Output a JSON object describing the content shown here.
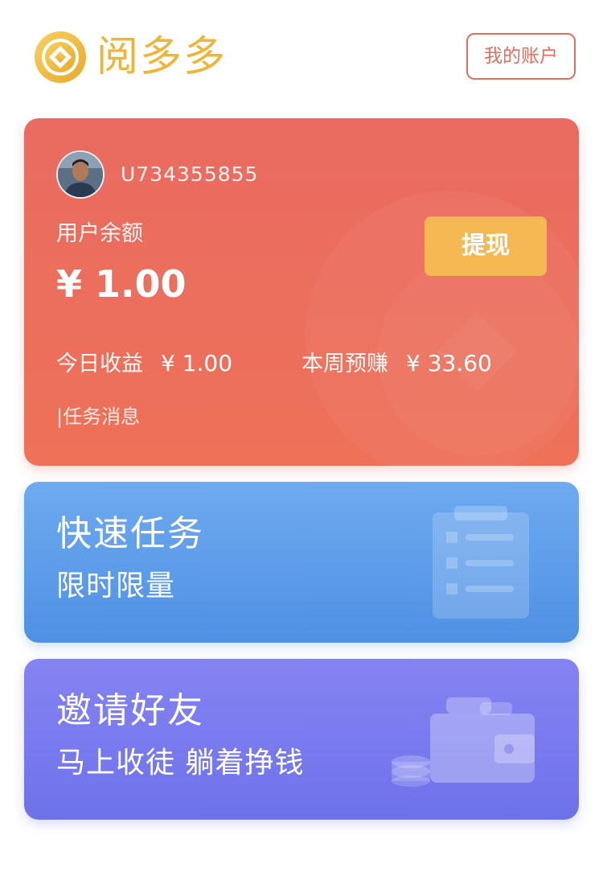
{
  "header": {
    "app_title": "阅多多",
    "account_button": "我的账户"
  },
  "balance_card": {
    "user_id": "U734355855",
    "balance_label": "用户余额",
    "balance_value": "¥ 1.00",
    "withdraw_button": "提现",
    "today_label": "今日收益",
    "today_value": "¥ 1.00",
    "week_label": "本周预赚",
    "week_value": "¥ 33.60",
    "task_message": "|任务消息"
  },
  "quick_task": {
    "title": "快速任务",
    "subtitle": "限时限量"
  },
  "invite": {
    "title": "邀请好友",
    "subtitle": "马上收徒 躺着挣钱"
  },
  "icons": {
    "logo": "coin-logo-icon",
    "quick_task": "clipboard-list-icon",
    "invite": "wallet-icon"
  },
  "colors": {
    "brand_gold": "#efb53a",
    "account_red": "#e56e5e",
    "balance_card": "#ea6b61",
    "withdraw_button": "#f6b852",
    "quick_task_card": "#5e9deb",
    "invite_card": "#7a7af0"
  }
}
